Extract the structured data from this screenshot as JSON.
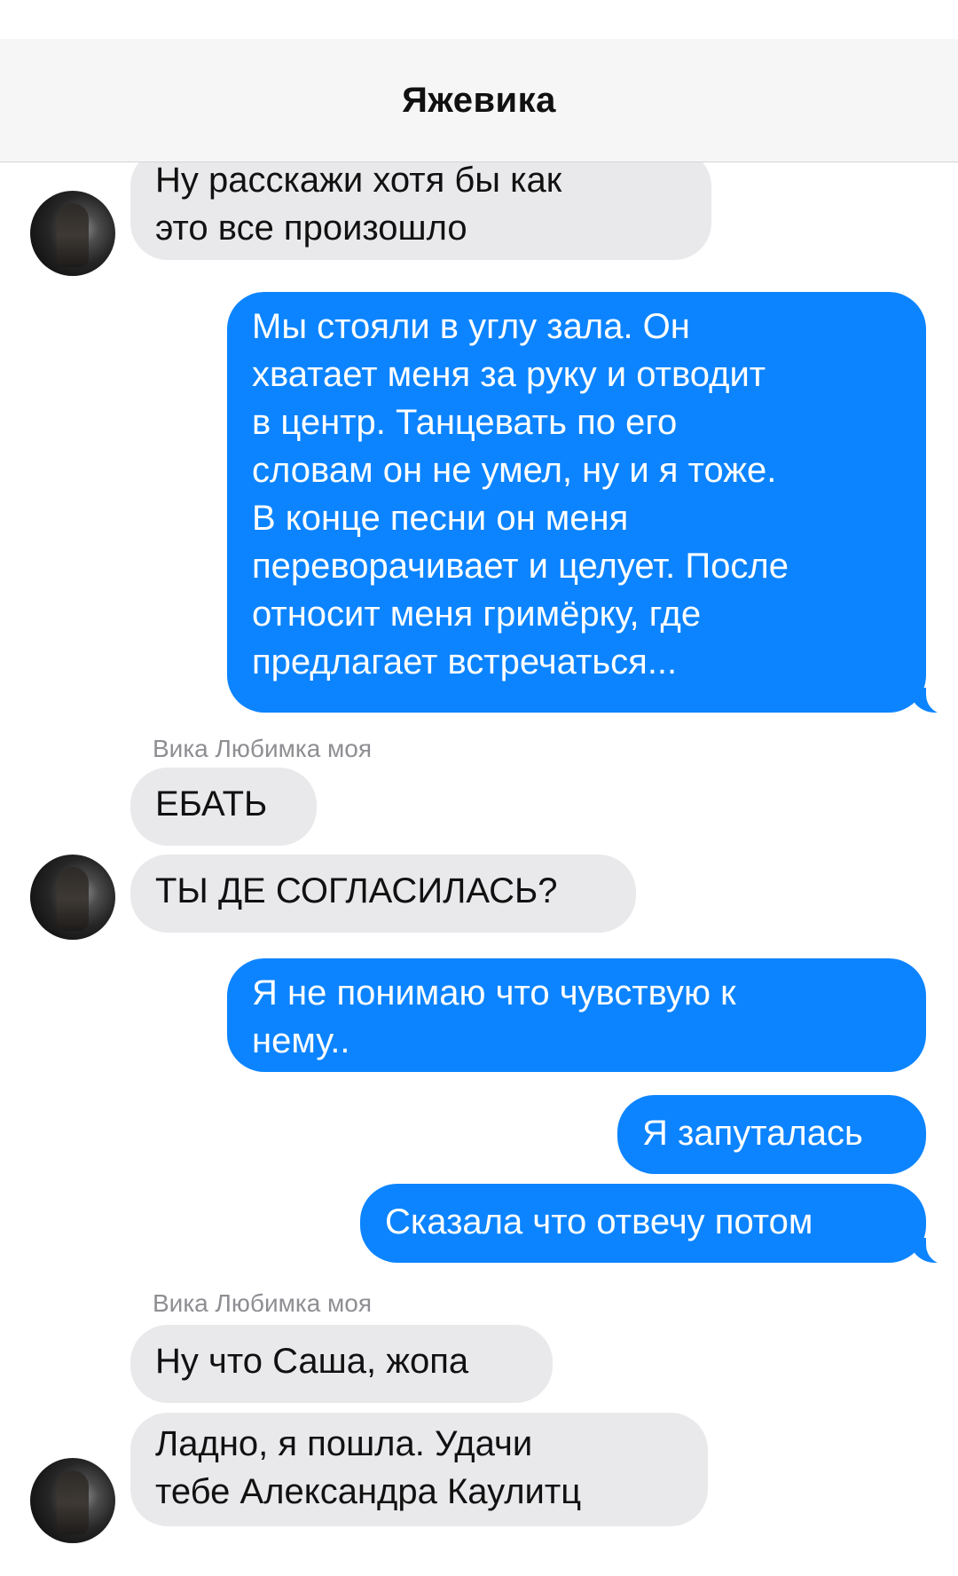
{
  "header": {
    "title": "Яжевика"
  },
  "avatars": {
    "icon": "contact-avatar"
  },
  "messages": [
    {
      "side": "in",
      "text": "Ну расскажи хотя бы как\nэто все произошло"
    },
    {
      "side": "out",
      "text": "Мы стояли в углу зала. Он\nхватает меня за руку и отводит\nв центр. Танцевать по его\nсловам он не умел, ну и я тоже.\nВ конце песни он меня\nпереворачивает и целует. После\nотносит меня гримёрку, где\nпредлагает встречаться..."
    },
    {
      "side": "in",
      "sender": "Вика Любимка моя",
      "text": "ЕБАТЬ"
    },
    {
      "side": "in",
      "text": "ТЫ ДЕ СОГЛАСИЛАСЬ?"
    },
    {
      "side": "out",
      "text": "Я не понимаю что чувствую к\nнему.."
    },
    {
      "side": "out",
      "text": "Я запуталась"
    },
    {
      "side": "out",
      "text": "Сказала что отвечу потом"
    },
    {
      "side": "in",
      "sender": "Вика Любимка моя",
      "text": "Ну что Саша, жопа"
    },
    {
      "side": "in",
      "text": "Ладно, я пошла. Удачи\nтебе Александра Каулитц"
    }
  ],
  "colors": {
    "outgoing": "#0c84ff",
    "incoming": "#e9e9eb",
    "sender_label": "#8e8e93"
  }
}
